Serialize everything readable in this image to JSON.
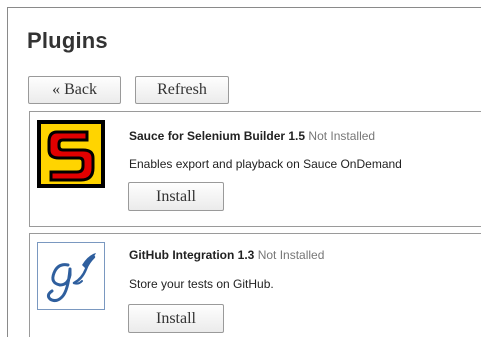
{
  "page": {
    "title": "Plugins",
    "back_label": "« Back",
    "refresh_label": "Refresh"
  },
  "plugins": [
    {
      "name": "Sauce for Selenium Builder 1.5",
      "status": "Not Installed",
      "description": "Enables export and playback on Sauce OnDemand",
      "install_label": "Install",
      "icon": "sauce-labs-logo-icon",
      "colors": {
        "background": "#000000",
        "logo": "#ffd400",
        "stroke": "#e10000"
      }
    },
    {
      "name": "GitHub Integration 1.3",
      "status": "Not Installed",
      "description": "Store your tests on GitHub.",
      "install_label": "Install",
      "icon": "github-quill-logo-icon",
      "colors": {
        "logo": "#2f5f9e"
      }
    }
  ]
}
